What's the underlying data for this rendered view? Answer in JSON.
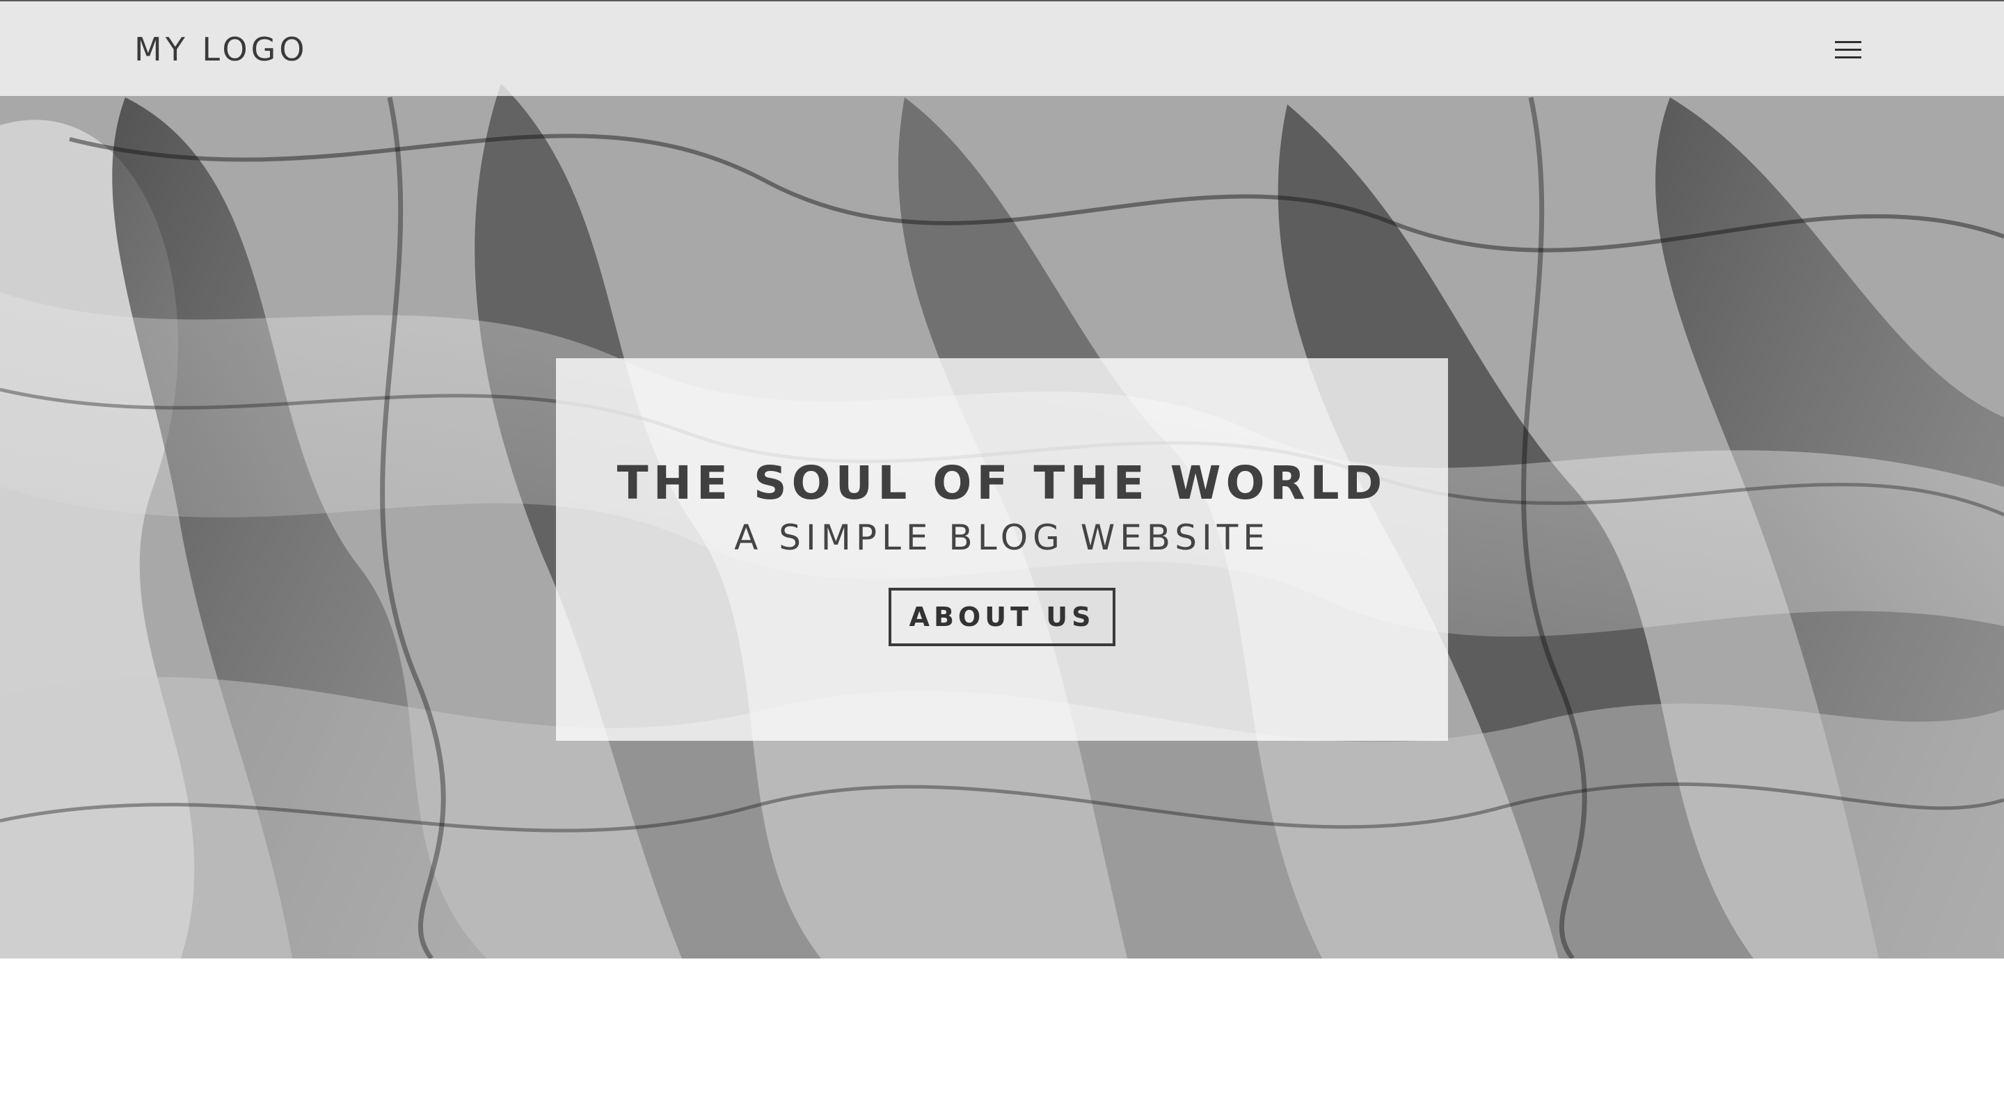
{
  "header": {
    "logo_text": "MY LOGO",
    "menu_icon": "hamburger-menu-icon"
  },
  "hero": {
    "background": "abstract-smoke-image",
    "title": "THE SOUL OF THE WORLD",
    "subtitle": "A SIMPLE BLOG WEBSITE",
    "cta_label": "ABOUT US"
  },
  "colors": {
    "text_dark": "#404040",
    "header_bg": "#ffffff",
    "card_bg": "#ffffff"
  }
}
